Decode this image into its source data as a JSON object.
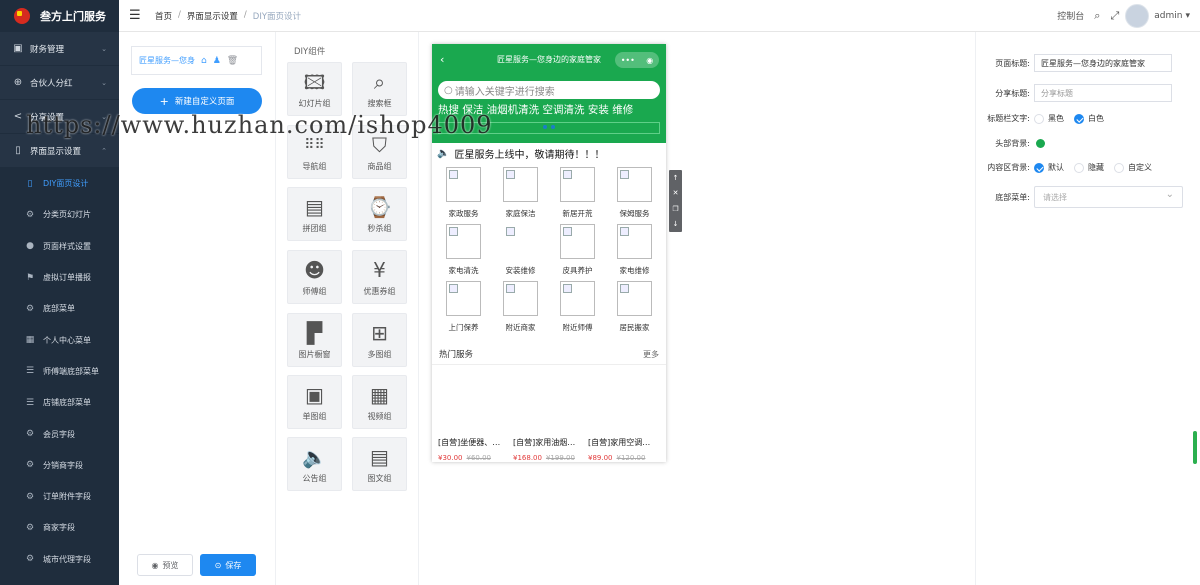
{
  "app": {
    "title": "叁方上门服务"
  },
  "sidebar": {
    "groups": [
      {
        "label": "财务管理",
        "icon": "wallet-icon"
      },
      {
        "label": "合伙人分红",
        "icon": "globe-icon"
      },
      {
        "label": "分享设置",
        "icon": "share-icon"
      },
      {
        "label": "界面显示设置",
        "icon": "phone-icon"
      }
    ],
    "subitems": [
      {
        "label": "DIY面页设计",
        "icon": "phone-icon"
      },
      {
        "label": "分类页幻灯片",
        "icon": "gear-icon"
      },
      {
        "label": "页面样式设置",
        "icon": "user-icon"
      },
      {
        "label": "虚拟订单播报",
        "icon": "flag-icon"
      },
      {
        "label": "底部菜单",
        "icon": "gear-icon"
      },
      {
        "label": "个人中心菜单",
        "icon": "grid-icon"
      },
      {
        "label": "师傅端底部菜单",
        "icon": "sliders-icon"
      },
      {
        "label": "店铺底部菜单",
        "icon": "sliders-icon"
      },
      {
        "label": "会员字段",
        "icon": "gear-icon"
      },
      {
        "label": "分销商字段",
        "icon": "gear-icon"
      },
      {
        "label": "订单附件字段",
        "icon": "gear-icon"
      },
      {
        "label": "商家字段",
        "icon": "gear-icon"
      },
      {
        "label": "城市代理字段",
        "icon": "gear-icon"
      }
    ]
  },
  "header": {
    "breadcrumb": [
      "首页",
      "界面显示设置",
      "DIY面页设计"
    ],
    "console": "控制台",
    "user": "admin"
  },
  "pages_panel": {
    "page_name": "匠星服务—您身",
    "new_page": "新建自定义页面",
    "preview": "预览",
    "save": "保存"
  },
  "components": {
    "title": "DIY组件",
    "items": [
      {
        "label": "幻灯片组",
        "icon": "image-icon"
      },
      {
        "label": "搜索框",
        "icon": "search-icon"
      },
      {
        "label": "导航组",
        "icon": "dots-grid-icon"
      },
      {
        "label": "商品组",
        "icon": "bag-icon"
      },
      {
        "label": "拼团组",
        "icon": "group-buy-icon"
      },
      {
        "label": "秒杀组",
        "icon": "flash-sale-icon"
      },
      {
        "label": "师傅组",
        "icon": "worker-icon"
      },
      {
        "label": "优惠券组",
        "icon": "coupon-icon"
      },
      {
        "label": "图片橱窗",
        "icon": "window-icon"
      },
      {
        "label": "多图组",
        "icon": "multi-image-icon"
      },
      {
        "label": "单图组",
        "icon": "single-image-icon"
      },
      {
        "label": "视频组",
        "icon": "video-icon"
      },
      {
        "label": "公告组",
        "icon": "speaker-icon"
      },
      {
        "label": "图文组",
        "icon": "article-icon"
      }
    ]
  },
  "phone": {
    "nav_title": "匠星服务—您身边的家庭管家",
    "search_placeholder": "请输入关键字进行搜索",
    "hot_words": "热搜 保洁 油烟机清洗 空调清洗 安装 维修",
    "notice": "匠星服务上线中，敬请期待！！！",
    "grid": [
      "家政服务",
      "家庭保洁",
      "新居开荒",
      "保姆服务",
      "家电清洗",
      "安装维修",
      "皮具养护",
      "家电维修",
      "上门保养",
      "附近商家",
      "附近师傅",
      "居民搬家"
    ],
    "hot_title": "热门服务",
    "hot_more": "更多",
    "products": [
      {
        "name": "[自营]坐便器、…",
        "price": "¥30.00",
        "orig": "¥60.00"
      },
      {
        "name": "[自营]家用油烟…",
        "price": "¥168.00",
        "orig": "¥199.00"
      },
      {
        "name": "[自营]家用空调…",
        "price": "¥89.00",
        "orig": "¥120.00"
      }
    ]
  },
  "watermark": "https://www.huzhan.com/ishop4009",
  "props": {
    "page_title_label": "页面标题:",
    "page_title_value": "匠星服务—您身边的家庭管家",
    "share_title_label": "分享标题:",
    "share_title_placeholder": "分享标题",
    "titlebar_text_label": "标题栏文字:",
    "text_black": "黑色",
    "text_white": "白色",
    "head_bg_label": "头部背景:",
    "content_bg_label": "内容区背景:",
    "bg_default": "默认",
    "bg_hidden": "隐藏",
    "bg_custom": "自定义",
    "bottom_menu_label": "底部菜单:",
    "bottom_menu_placeholder": "请选择"
  },
  "colors": {
    "accent": "#1e88f0",
    "green": "#1aa84f",
    "sidebar": "#1f2d3d"
  }
}
